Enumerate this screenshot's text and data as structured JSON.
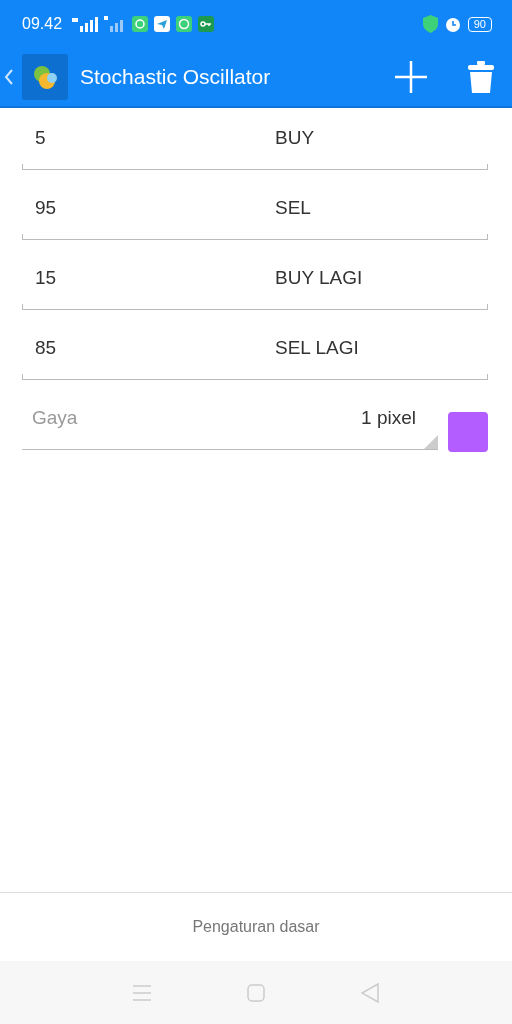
{
  "status_bar": {
    "time": "09.42",
    "battery": "90"
  },
  "app_bar": {
    "title": "Stochastic Oscillator"
  },
  "levels": [
    {
      "value": "5",
      "label": "BUY"
    },
    {
      "value": "95",
      "label": "SEL"
    },
    {
      "value": "15",
      "label": "BUY LAGI"
    },
    {
      "value": "85",
      "label": "SEL LAGI"
    }
  ],
  "style": {
    "placeholder": "Gaya",
    "value": "1 pixel",
    "color": "#b35cff"
  },
  "footer": {
    "label": "Pengaturan dasar"
  }
}
